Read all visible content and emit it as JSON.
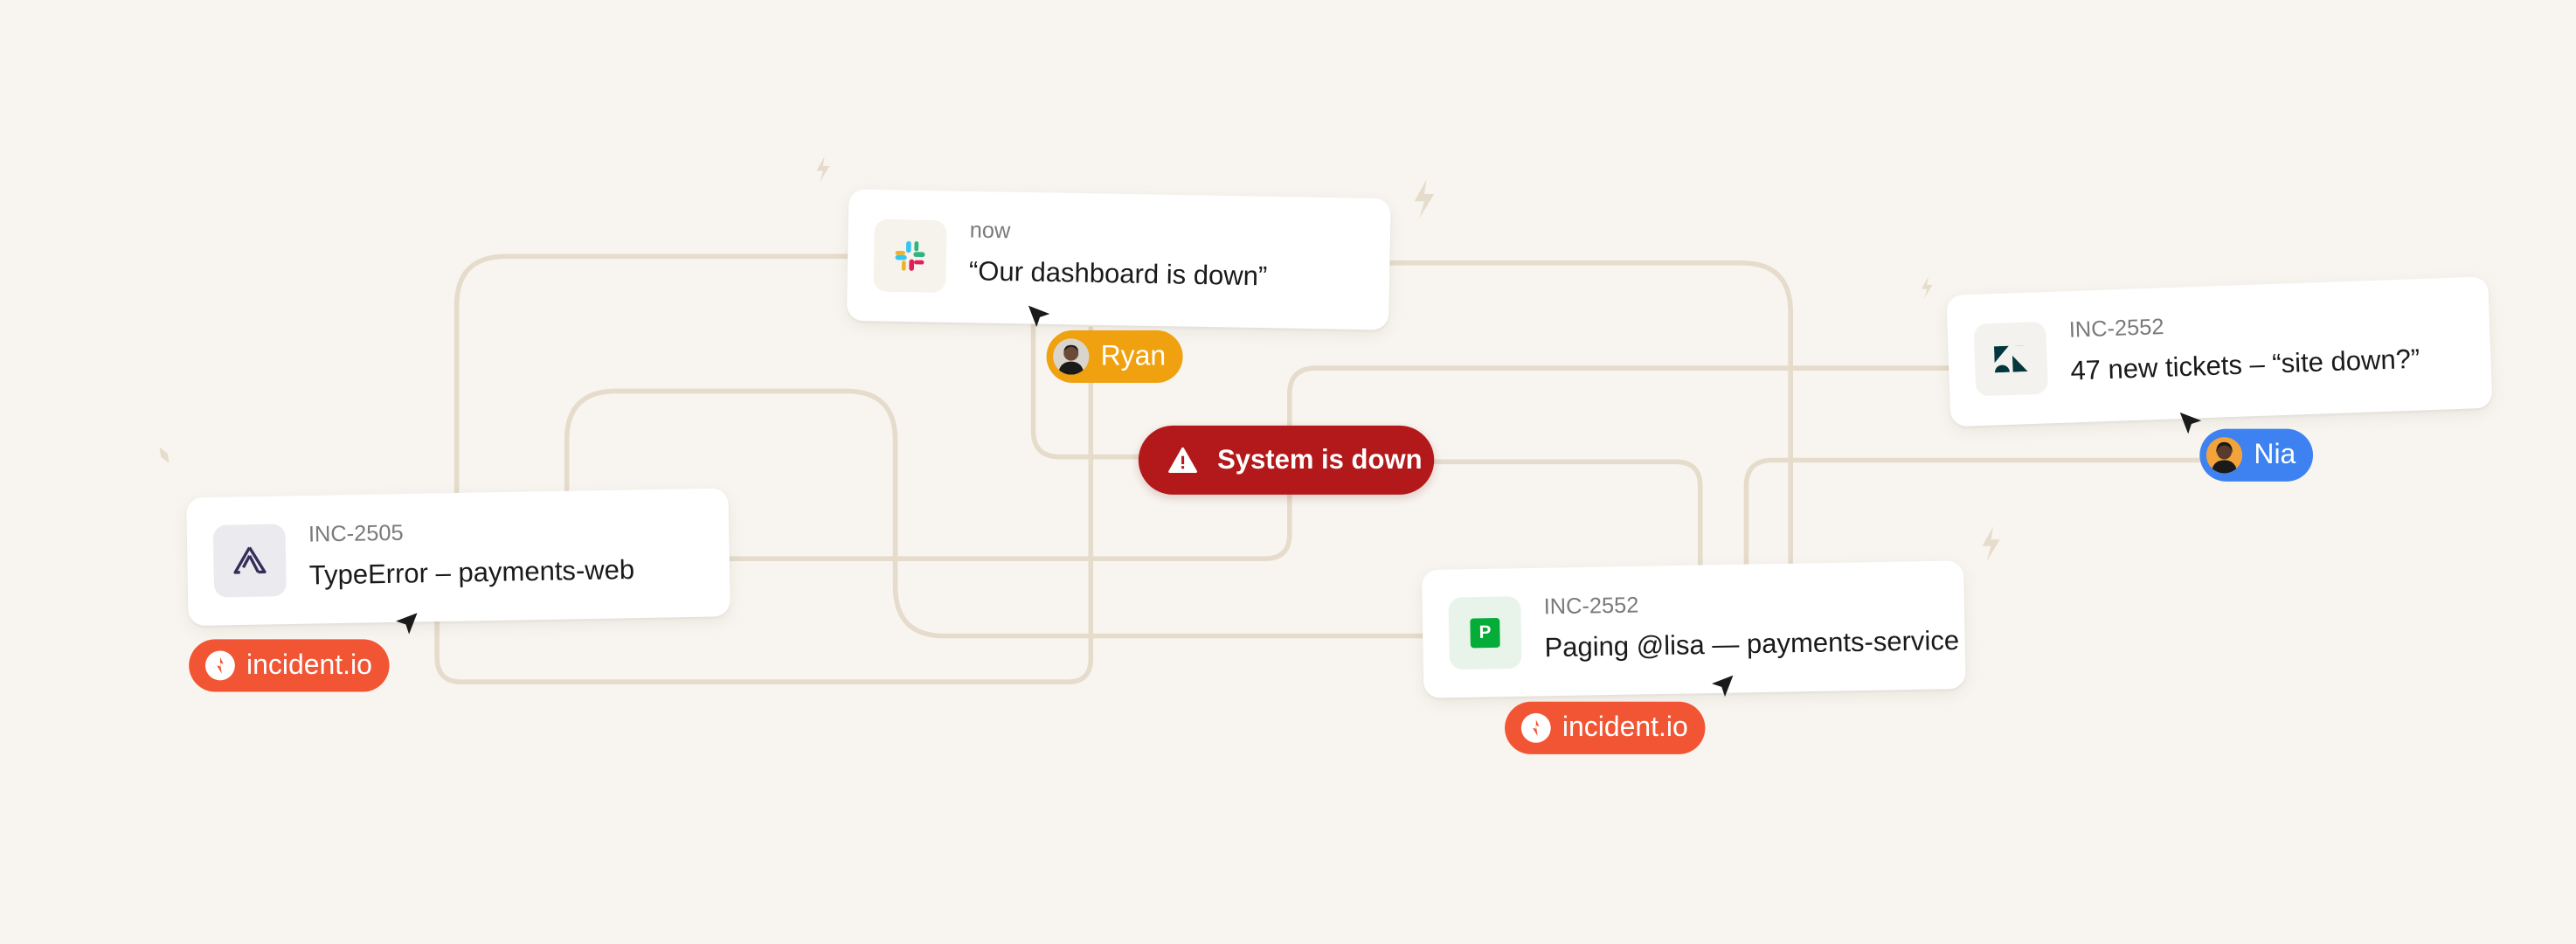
{
  "colors": {
    "background": "#f8f5f0",
    "connector": "#e6dccb",
    "alert": "#b3191b",
    "brand_orange": "#f25533",
    "ryan_yellow": "#f0a10f",
    "nia_blue": "#3d82f0"
  },
  "alert": {
    "label": "System is down",
    "icon": "warning-icon"
  },
  "cards": {
    "slack": {
      "icon": "slack-icon",
      "meta": "now",
      "title": "“Our dashboard is down”"
    },
    "sentry": {
      "icon": "sentry-icon",
      "meta": "INC-2505",
      "title": "TypeError – payments-web"
    },
    "pagerduty": {
      "icon": "pagerduty-icon",
      "meta": "INC-2552",
      "title": "Paging @lisa — payments-service"
    },
    "zendesk": {
      "icon": "zendesk-icon",
      "meta": "INC-2552",
      "title": "47 new tickets – “site down?”"
    }
  },
  "pills": {
    "ryan": {
      "label": "Ryan",
      "icon": "avatar"
    },
    "nia": {
      "label": "Nia",
      "icon": "avatar"
    },
    "incident_left": {
      "label": "incident.io",
      "icon": "incident-logo-icon"
    },
    "incident_mid": {
      "label": "incident.io",
      "icon": "incident-logo-icon"
    }
  }
}
